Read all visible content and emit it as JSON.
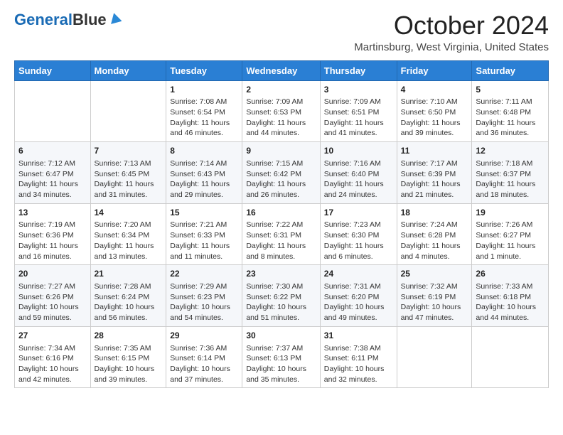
{
  "header": {
    "logo_general": "General",
    "logo_blue": "Blue",
    "month": "October 2024",
    "location": "Martinsburg, West Virginia, United States"
  },
  "days_of_week": [
    "Sunday",
    "Monday",
    "Tuesday",
    "Wednesday",
    "Thursday",
    "Friday",
    "Saturday"
  ],
  "weeks": [
    [
      {
        "day": "",
        "info": ""
      },
      {
        "day": "",
        "info": ""
      },
      {
        "day": "1",
        "info": "Sunrise: 7:08 AM\nSunset: 6:54 PM\nDaylight: 11 hours and 46 minutes."
      },
      {
        "day": "2",
        "info": "Sunrise: 7:09 AM\nSunset: 6:53 PM\nDaylight: 11 hours and 44 minutes."
      },
      {
        "day": "3",
        "info": "Sunrise: 7:09 AM\nSunset: 6:51 PM\nDaylight: 11 hours and 41 minutes."
      },
      {
        "day": "4",
        "info": "Sunrise: 7:10 AM\nSunset: 6:50 PM\nDaylight: 11 hours and 39 minutes."
      },
      {
        "day": "5",
        "info": "Sunrise: 7:11 AM\nSunset: 6:48 PM\nDaylight: 11 hours and 36 minutes."
      }
    ],
    [
      {
        "day": "6",
        "info": "Sunrise: 7:12 AM\nSunset: 6:47 PM\nDaylight: 11 hours and 34 minutes."
      },
      {
        "day": "7",
        "info": "Sunrise: 7:13 AM\nSunset: 6:45 PM\nDaylight: 11 hours and 31 minutes."
      },
      {
        "day": "8",
        "info": "Sunrise: 7:14 AM\nSunset: 6:43 PM\nDaylight: 11 hours and 29 minutes."
      },
      {
        "day": "9",
        "info": "Sunrise: 7:15 AM\nSunset: 6:42 PM\nDaylight: 11 hours and 26 minutes."
      },
      {
        "day": "10",
        "info": "Sunrise: 7:16 AM\nSunset: 6:40 PM\nDaylight: 11 hours and 24 minutes."
      },
      {
        "day": "11",
        "info": "Sunrise: 7:17 AM\nSunset: 6:39 PM\nDaylight: 11 hours and 21 minutes."
      },
      {
        "day": "12",
        "info": "Sunrise: 7:18 AM\nSunset: 6:37 PM\nDaylight: 11 hours and 18 minutes."
      }
    ],
    [
      {
        "day": "13",
        "info": "Sunrise: 7:19 AM\nSunset: 6:36 PM\nDaylight: 11 hours and 16 minutes."
      },
      {
        "day": "14",
        "info": "Sunrise: 7:20 AM\nSunset: 6:34 PM\nDaylight: 11 hours and 13 minutes."
      },
      {
        "day": "15",
        "info": "Sunrise: 7:21 AM\nSunset: 6:33 PM\nDaylight: 11 hours and 11 minutes."
      },
      {
        "day": "16",
        "info": "Sunrise: 7:22 AM\nSunset: 6:31 PM\nDaylight: 11 hours and 8 minutes."
      },
      {
        "day": "17",
        "info": "Sunrise: 7:23 AM\nSunset: 6:30 PM\nDaylight: 11 hours and 6 minutes."
      },
      {
        "day": "18",
        "info": "Sunrise: 7:24 AM\nSunset: 6:28 PM\nDaylight: 11 hours and 4 minutes."
      },
      {
        "day": "19",
        "info": "Sunrise: 7:26 AM\nSunset: 6:27 PM\nDaylight: 11 hours and 1 minute."
      }
    ],
    [
      {
        "day": "20",
        "info": "Sunrise: 7:27 AM\nSunset: 6:26 PM\nDaylight: 10 hours and 59 minutes."
      },
      {
        "day": "21",
        "info": "Sunrise: 7:28 AM\nSunset: 6:24 PM\nDaylight: 10 hours and 56 minutes."
      },
      {
        "day": "22",
        "info": "Sunrise: 7:29 AM\nSunset: 6:23 PM\nDaylight: 10 hours and 54 minutes."
      },
      {
        "day": "23",
        "info": "Sunrise: 7:30 AM\nSunset: 6:22 PM\nDaylight: 10 hours and 51 minutes."
      },
      {
        "day": "24",
        "info": "Sunrise: 7:31 AM\nSunset: 6:20 PM\nDaylight: 10 hours and 49 minutes."
      },
      {
        "day": "25",
        "info": "Sunrise: 7:32 AM\nSunset: 6:19 PM\nDaylight: 10 hours and 47 minutes."
      },
      {
        "day": "26",
        "info": "Sunrise: 7:33 AM\nSunset: 6:18 PM\nDaylight: 10 hours and 44 minutes."
      }
    ],
    [
      {
        "day": "27",
        "info": "Sunrise: 7:34 AM\nSunset: 6:16 PM\nDaylight: 10 hours and 42 minutes."
      },
      {
        "day": "28",
        "info": "Sunrise: 7:35 AM\nSunset: 6:15 PM\nDaylight: 10 hours and 39 minutes."
      },
      {
        "day": "29",
        "info": "Sunrise: 7:36 AM\nSunset: 6:14 PM\nDaylight: 10 hours and 37 minutes."
      },
      {
        "day": "30",
        "info": "Sunrise: 7:37 AM\nSunset: 6:13 PM\nDaylight: 10 hours and 35 minutes."
      },
      {
        "day": "31",
        "info": "Sunrise: 7:38 AM\nSunset: 6:11 PM\nDaylight: 10 hours and 32 minutes."
      },
      {
        "day": "",
        "info": ""
      },
      {
        "day": "",
        "info": ""
      }
    ]
  ]
}
